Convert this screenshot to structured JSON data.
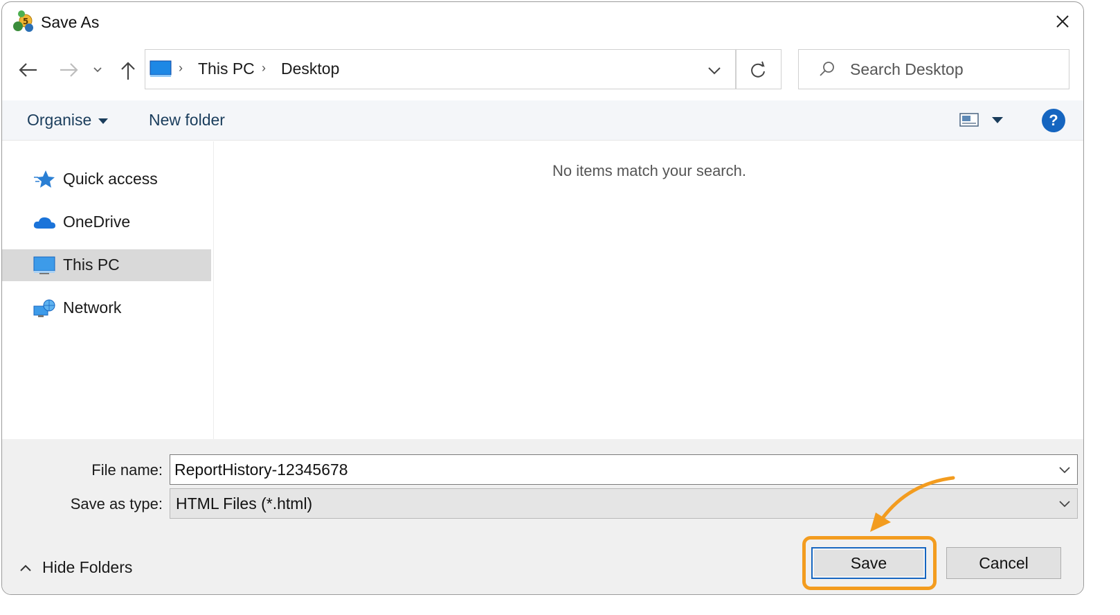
{
  "window": {
    "title": "Save As",
    "app_icon": "metatrader-app-icon",
    "close_icon": "close-icon"
  },
  "navigation": {
    "back_icon": "back-arrow-icon",
    "forward_icon": "forward-arrow-icon",
    "recent_icon": "chevron-down-icon",
    "up_icon": "up-arrow-icon"
  },
  "address_bar": {
    "breadcrumbs": [
      "This PC",
      "Desktop"
    ],
    "separator": "›",
    "dropdown_icon": "chevron-down-icon",
    "refresh_icon": "refresh-icon"
  },
  "search": {
    "placeholder": "Search Desktop",
    "value": ""
  },
  "command_bar": {
    "organise_label": "Organise",
    "new_folder_label": "New folder",
    "help_label": "?"
  },
  "nav_pane": {
    "items": [
      {
        "label": "Quick access",
        "icon": "star-icon",
        "selected": false
      },
      {
        "label": "OneDrive",
        "icon": "cloud-icon",
        "selected": false
      },
      {
        "label": "This PC",
        "icon": "monitor-icon",
        "selected": true
      },
      {
        "label": "Network",
        "icon": "network-icon",
        "selected": false
      }
    ]
  },
  "content": {
    "empty_message": "No items match your search."
  },
  "form": {
    "file_name_label": "File name:",
    "file_name_value": "ReportHistory-12345678",
    "save_type_label": "Save as type:",
    "save_type_value": "HTML Files (*.html)"
  },
  "footer": {
    "hide_folders_label": "Hide Folders",
    "save_label": "Save",
    "cancel_label": "Cancel"
  },
  "colors": {
    "highlight": "#f39c1f",
    "accent": "#1565c0",
    "command_bar_bg": "#f4f6f9",
    "footer_bg": "#f0f0f0"
  }
}
